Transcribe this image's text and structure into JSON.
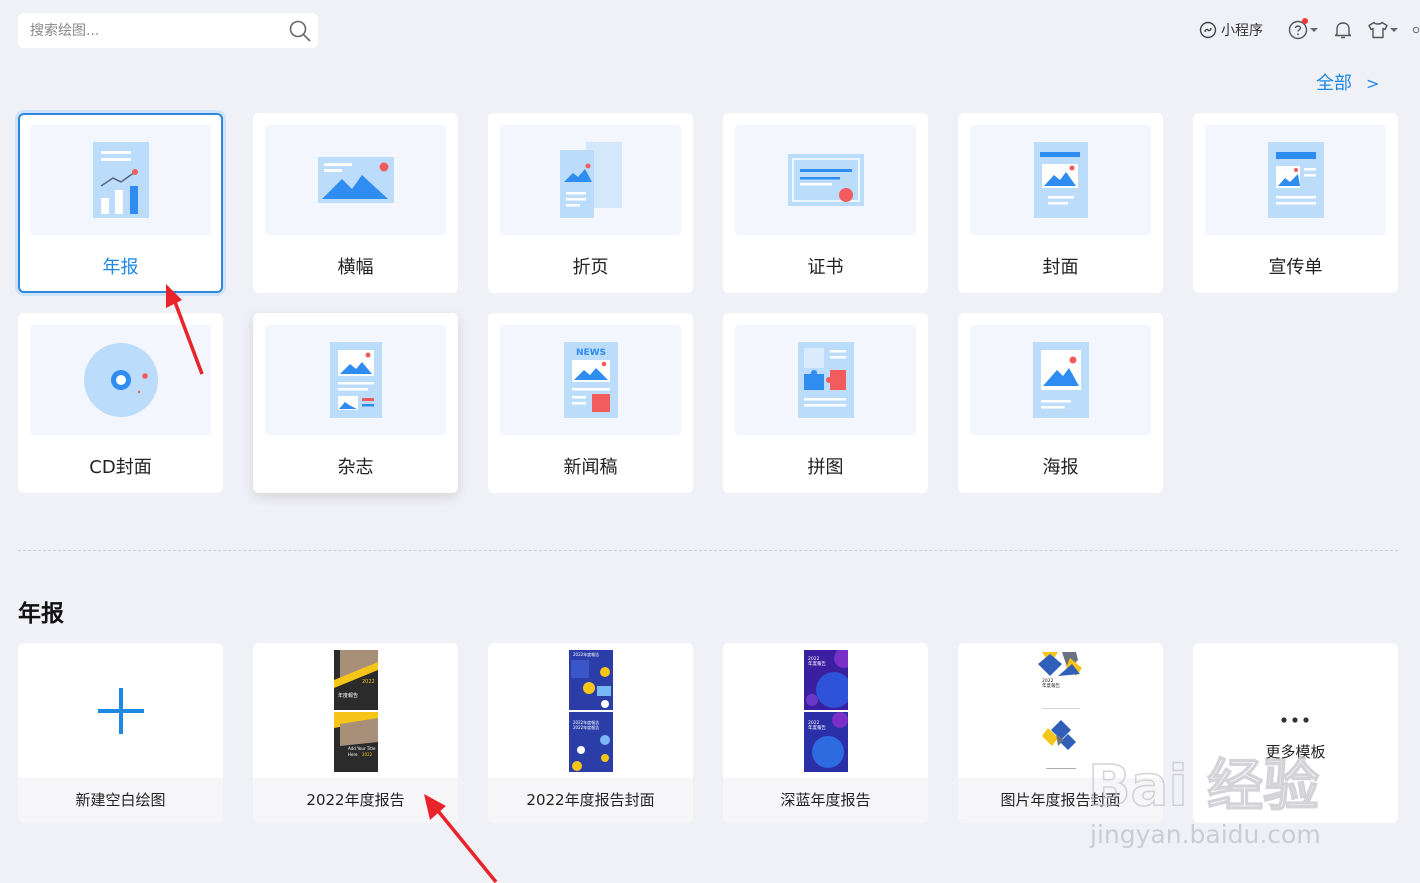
{
  "search": {
    "placeholder": "搜索绘图..."
  },
  "header": {
    "mini_program": "小程序",
    "all_link": "全部",
    "all_link_arrow": ">"
  },
  "categories": [
    {
      "label": "年报"
    },
    {
      "label": "横幅"
    },
    {
      "label": "折页"
    },
    {
      "label": "证书"
    },
    {
      "label": "封面"
    },
    {
      "label": "宣传单"
    },
    {
      "label": "CD封面"
    },
    {
      "label": "杂志"
    },
    {
      "label": "新闻稿"
    },
    {
      "label": "拼图"
    },
    {
      "label": "海报"
    }
  ],
  "section": {
    "title": "年报"
  },
  "templates": [
    {
      "label": "新建空白绘图"
    },
    {
      "label": "2022年度报告",
      "preview_text": [
        "2022",
        "年度報告",
        "Add Your Title",
        "Here",
        "2022"
      ]
    },
    {
      "label": "2022年度报告封面",
      "preview_text": [
        "2022年度報告",
        "2022年度報告",
        "2022年度報告"
      ]
    },
    {
      "label": "深蓝年度报告",
      "preview_text": [
        "2022",
        "年度報告",
        "2022",
        "年度報告"
      ]
    },
    {
      "label": "图片年度报告封面",
      "preview_text": [
        "2022",
        "年度報告"
      ]
    }
  ],
  "more": {
    "label": "更多模板"
  },
  "news_badge": "NEWS",
  "watermark": {
    "text": "Bai 经验",
    "url": "jingyan.baidu.com"
  },
  "colors": {
    "accent": "#1e88e5",
    "icon_light": "#bcdcfb",
    "icon_mid": "#2f8cf0",
    "icon_red": "#f25c5c",
    "arrow": "#e8232a"
  }
}
